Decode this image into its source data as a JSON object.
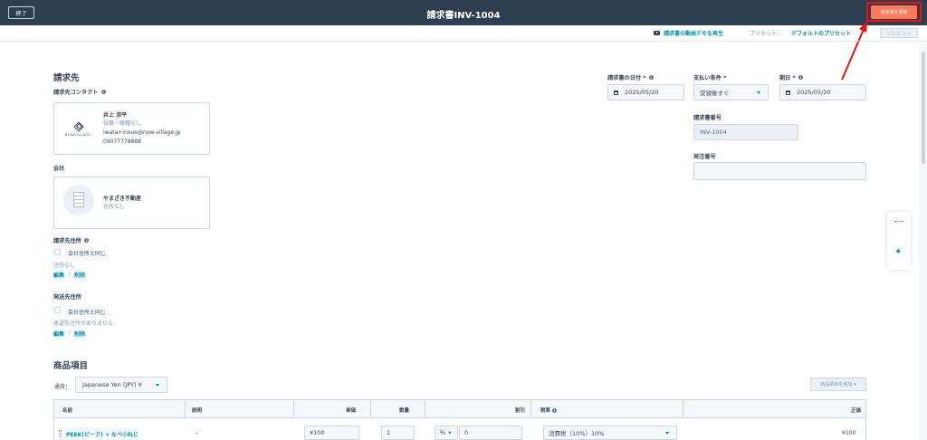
{
  "header": {
    "exit_label": "終了",
    "title": "請求書INV-1004",
    "update_label": "請求書を更新"
  },
  "subbar": {
    "demo_label": "請求書の動画デモを再生",
    "preset_label": "プリセット：",
    "preset_value": "デフォルトのプリセット",
    "preview_label": "プレビュー"
  },
  "billing": {
    "section_title": "請求先",
    "contact_label": "請求先コンタクト",
    "contact": {
      "logo_text": "NOWVILLAGE",
      "name": "井上 涼平",
      "title": "役職・職種なし",
      "email": "iwata+inoue@now-village.jp",
      "phone": "09077778888"
    },
    "company_label": "会社",
    "company": {
      "name": "やまざき不動産",
      "address": "住所なし"
    },
    "billing_address_label": "請求先住所",
    "same_as_company": "会社住所と同じ",
    "billing_address_value": "住所なし",
    "edit": "編集",
    "delete": "削除",
    "shipping_address_label": "発送先住所",
    "shipping_address_value": "発送先住所がありません"
  },
  "invoice_fields": {
    "invoice_date_label": "請求書の日付 *",
    "invoice_date": "2025/05/20",
    "payment_terms_label": "支払い条件 *",
    "payment_terms": "受領後すぐ",
    "due_date_label": "期日 *",
    "due_date": "2025/05/20",
    "invoice_number_label": "請求書番号",
    "invoice_number": "INV-1004",
    "po_number_label": "発注番号",
    "po_number": ""
  },
  "line_items": {
    "section_title": "商品項目",
    "currency_label": "通貨：",
    "currency_value": "Japanese Yen (JPY) ¥",
    "add_column": "商品項目を追加",
    "columns": [
      "名前",
      "説明",
      "単価",
      "数量",
      "割引",
      "税率",
      "正価"
    ],
    "rows": [
      {
        "name": "PEEK(ピーク) + なべ小ねじ",
        "description": "--",
        "unit_price": "¥100",
        "quantity": "1",
        "discount_unit": "%",
        "discount": "0",
        "tax": "消費税（10%）10%",
        "net_price": "¥100"
      }
    ]
  },
  "colors": {
    "header_bg": "#2d3e50",
    "accent": "#ff7a59",
    "link": "#0091ae",
    "highlight": "#ee1111"
  }
}
